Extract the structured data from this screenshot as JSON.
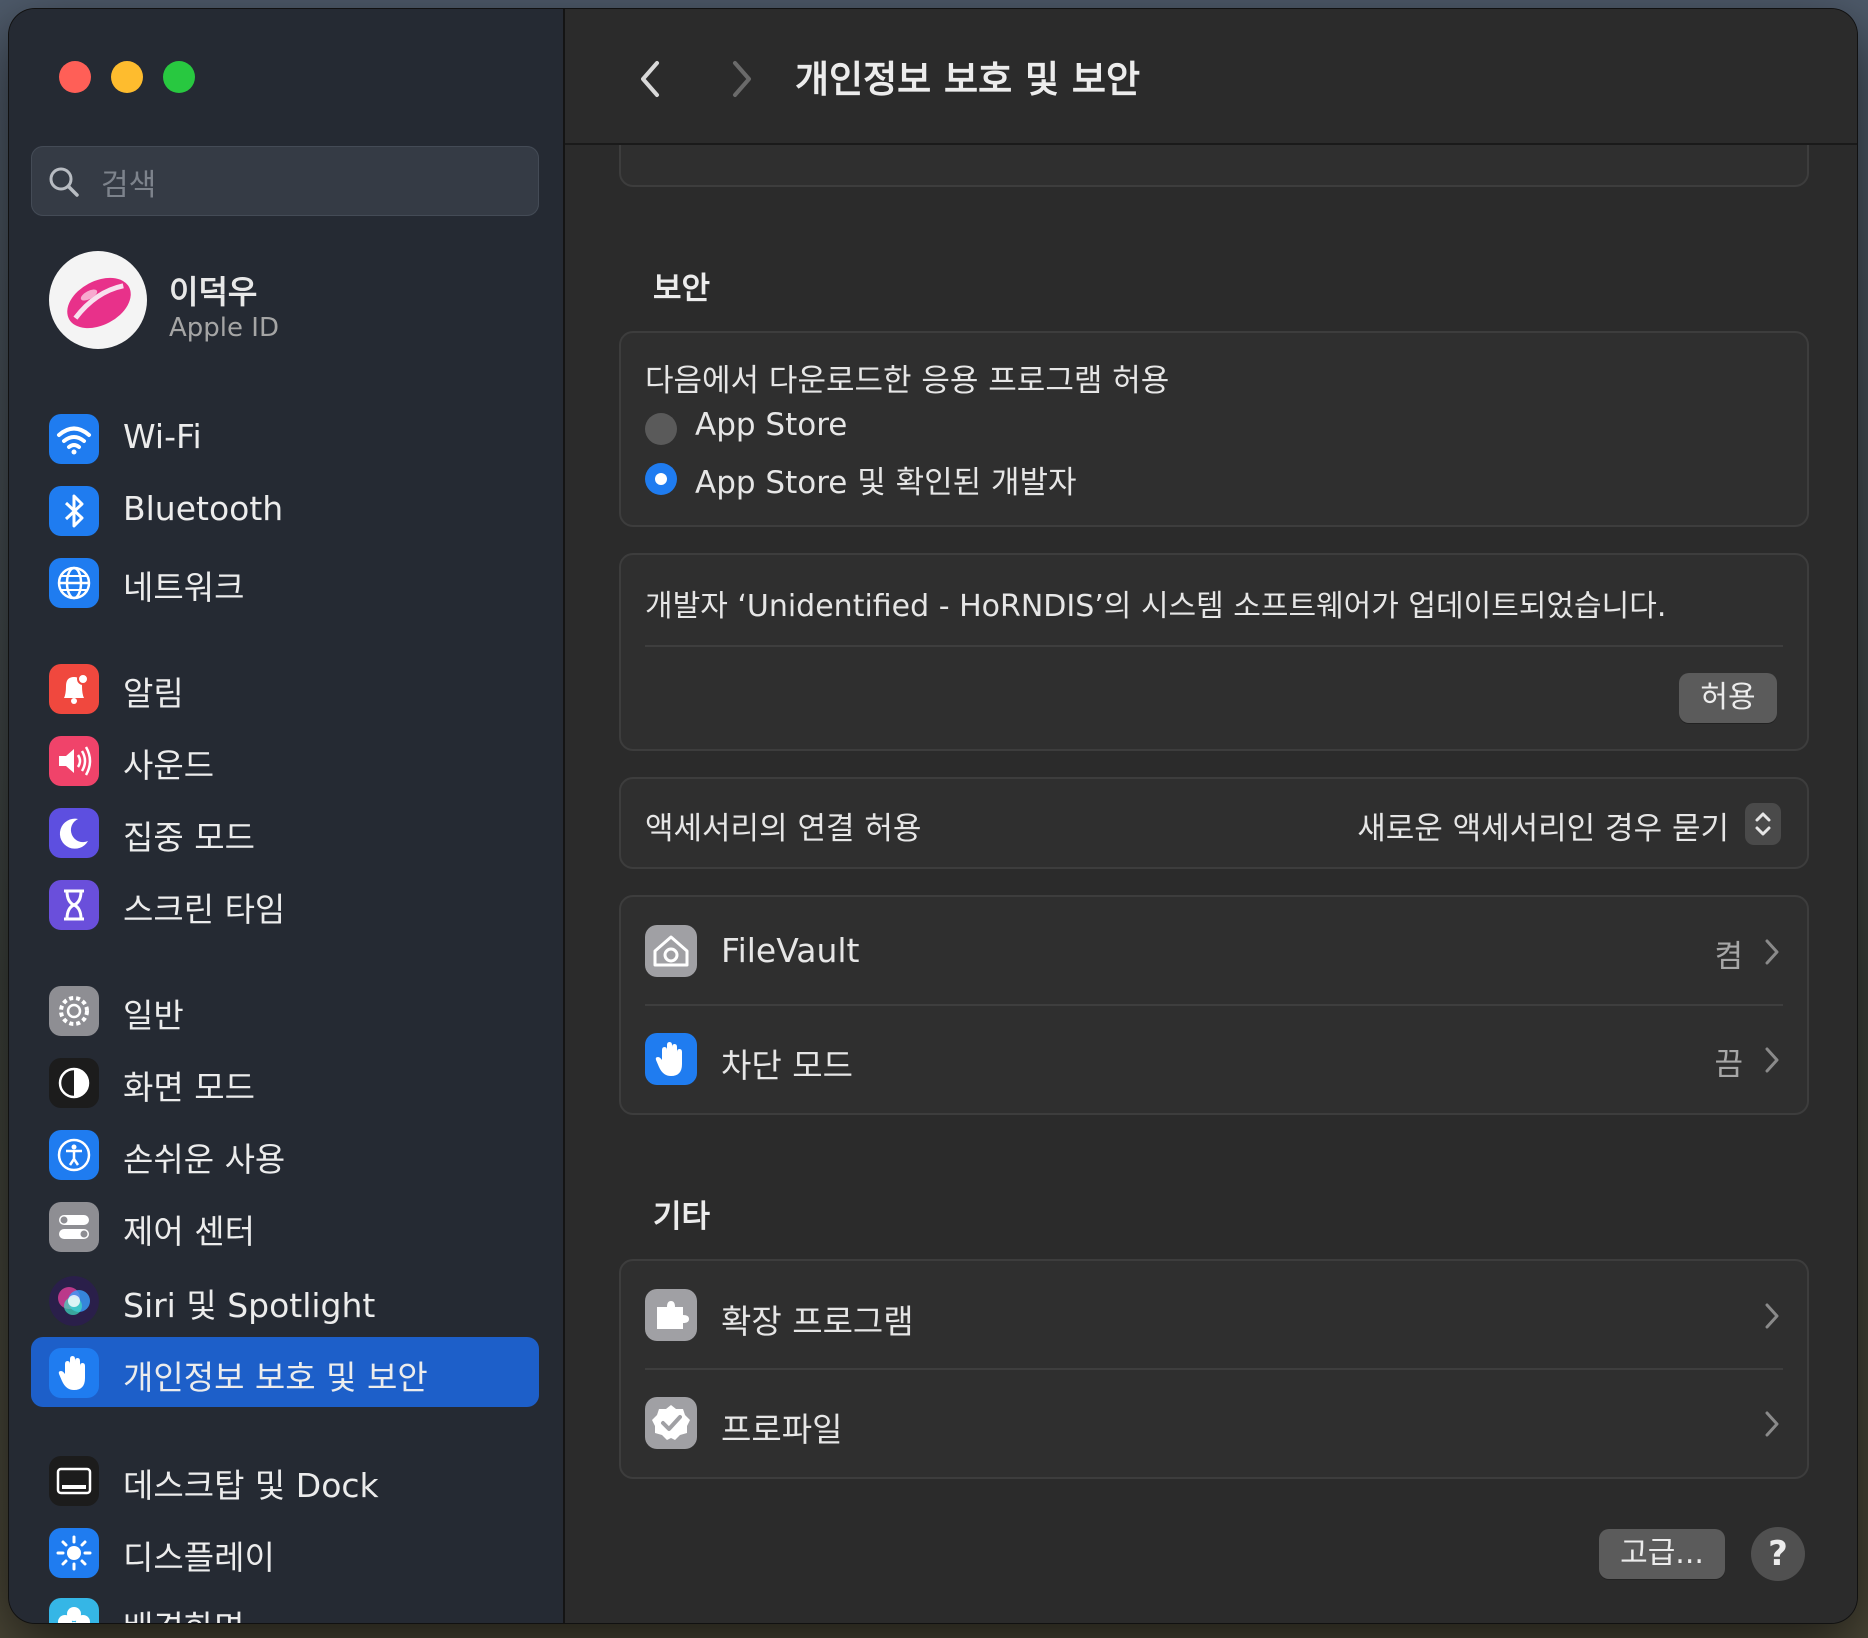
{
  "window": {
    "traffic_colors": [
      "#ff5f57",
      "#febc2e",
      "#28c840"
    ],
    "accent": "#1d5fc9"
  },
  "sidebar": {
    "search_placeholder": "검색",
    "profile": {
      "name": "이덕우",
      "subtitle": "Apple ID"
    },
    "items": [
      {
        "label": "Wi-Fi",
        "icon": "wifi-icon",
        "color": "#1f7cf0"
      },
      {
        "label": "Bluetooth",
        "icon": "bluetooth-icon",
        "color": "#1f7cf0"
      },
      {
        "label": "네트워크",
        "icon": "globe-icon",
        "color": "#1f7cf0"
      },
      {
        "label": "알림",
        "icon": "bell-icon",
        "color": "#f0483e"
      },
      {
        "label": "사운드",
        "icon": "speaker-icon",
        "color": "#f0436a"
      },
      {
        "label": "집중 모드",
        "icon": "moon-icon",
        "color": "#5d4fe0"
      },
      {
        "label": "스크린 타임",
        "icon": "hourglass-icon",
        "color": "#6a4fdb"
      },
      {
        "label": "일반",
        "icon": "gear-icon",
        "color": "#8e8e93"
      },
      {
        "label": "화면 모드",
        "icon": "appearance-icon",
        "color": "#1c1c1c"
      },
      {
        "label": "손쉬운 사용",
        "icon": "accessibility-icon",
        "color": "#1f7cf0"
      },
      {
        "label": "제어 센터",
        "icon": "toggles-icon",
        "color": "#8e8e93"
      },
      {
        "label": "Siri 및 Spotlight",
        "icon": "siri-icon",
        "color": "#3a2a6a"
      },
      {
        "label": "개인정보 보호 및 보안",
        "icon": "hand-icon",
        "color": "#1f7cf0",
        "selected": true
      },
      {
        "label": "데스크탑 및 Dock",
        "icon": "dock-icon",
        "color": "#1c1c1c"
      },
      {
        "label": "디스플레이",
        "icon": "sun-icon",
        "color": "#1f7cf0"
      },
      {
        "label": "배경화면",
        "icon": "flower-icon",
        "color": "#35b6e6"
      }
    ]
  },
  "header": {
    "title": "개인정보 보호 및 보안",
    "back": "back-chevron",
    "forward": "forward-chevron"
  },
  "security": {
    "section_title": "보안",
    "allow_apps_label": "다음에서 다운로드한 응용 프로그램 허용",
    "options": [
      {
        "label": "App Store",
        "selected": false
      },
      {
        "label": "App Store 및 확인된 개발자",
        "selected": true
      }
    ],
    "blocked_message": "개발자 ‘Unidentified - HoRNDIS’의 시스템 소프트웨어가 업데이트되었습니다.",
    "allow_button": "허용",
    "accessory_label": "액세서리의 연결 허용",
    "accessory_value": "새로운 액세서리인 경우 묻기",
    "rows": [
      {
        "label": "FileVault",
        "value": "켬",
        "icon": "filevault-icon"
      },
      {
        "label": "차단 모드",
        "value": "끔",
        "icon": "hand-icon"
      }
    ]
  },
  "other": {
    "section_title": "기타",
    "rows": [
      {
        "label": "확장 프로그램",
        "icon": "puzzle-icon"
      },
      {
        "label": "프로파일",
        "icon": "checkmark-badge-icon"
      }
    ]
  },
  "footer": {
    "advanced_button": "고급...",
    "help_button": "?"
  }
}
